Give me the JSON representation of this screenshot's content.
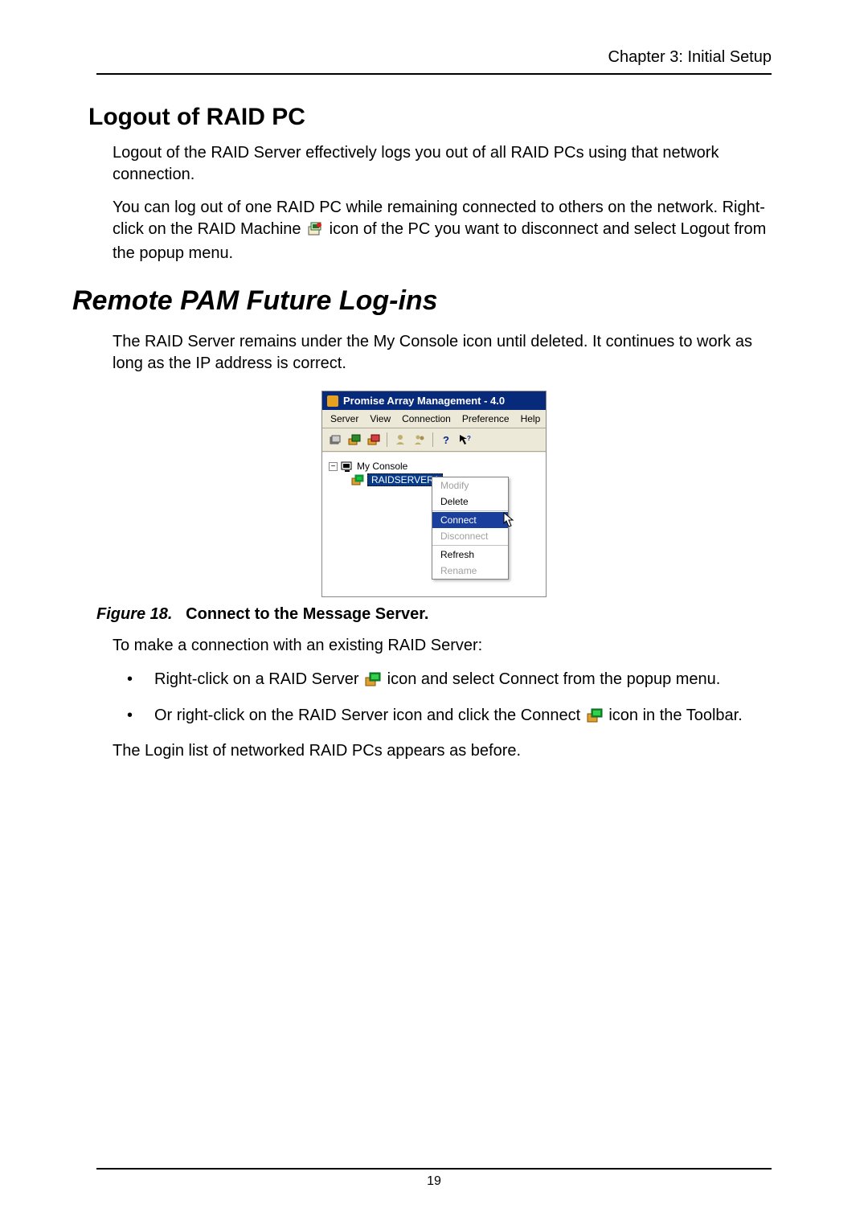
{
  "chapter_header": "Chapter 3: Initial Setup",
  "section_h2": "Logout of RAID PC",
  "para1": "Logout of the RAID Server effectively logs you out of all RAID PCs using that network connection.",
  "para2a": "You can log out of one RAID PC while remaining connected to others on the network. Right-click on the RAID Machine ",
  "para2b": " icon of the PC you want to disconnect and select Logout from the popup menu.",
  "section_h1": "Remote PAM Future Log-ins",
  "para3": "The RAID Server remains under the My Console icon until deleted. It continues to work as long as the IP address is correct.",
  "app_window": {
    "title": "Promise Array Management - 4.0",
    "menus": [
      "Server",
      "View",
      "Connection",
      "Preference",
      "Help"
    ],
    "tree_root": "My Console",
    "tree_selected": "RAIDSERVER1",
    "context_menu": {
      "modify": "Modify",
      "delete": "Delete",
      "connect": "Connect",
      "disconnect": "Disconnect",
      "refresh": "Refresh",
      "rename": "Rename"
    }
  },
  "figure_label": "Figure 18.",
  "figure_caption": "Connect to the Message Server.",
  "para4": "To make a connection with an existing RAID Server:",
  "bullet1a": "Right-click on a RAID Server ",
  "bullet1b": " icon and select Connect from the popup menu.",
  "bullet2a": "Or right-click on the RAID Server icon and click the Connect ",
  "bullet2b": " icon in the Toolbar.",
  "para5": "The Login list of networked RAID PCs appears as before.",
  "page_number": "19"
}
